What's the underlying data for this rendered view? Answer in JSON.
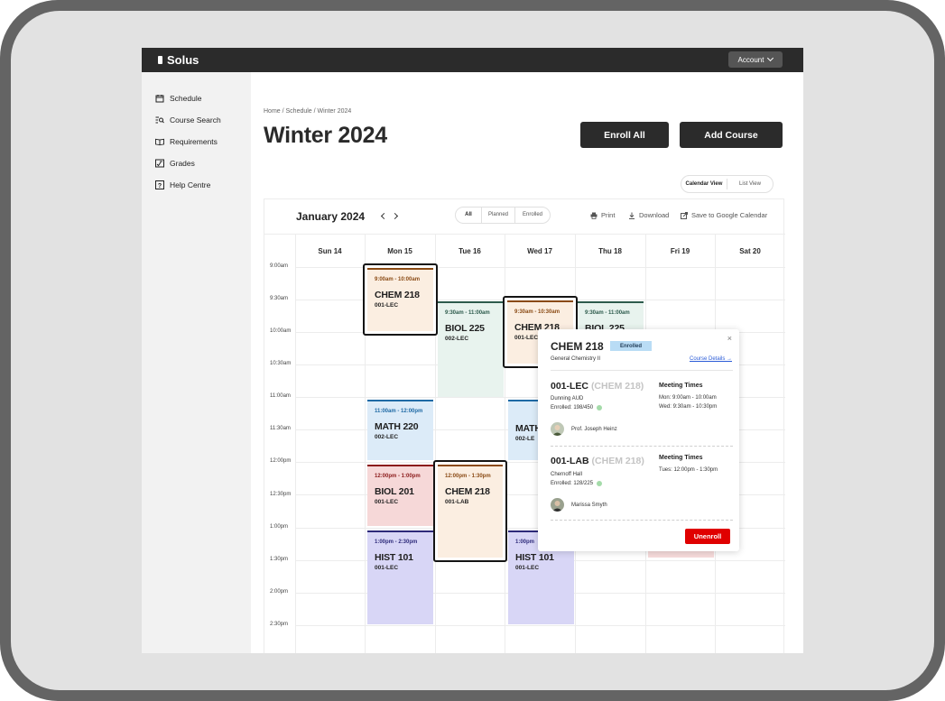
{
  "app": {
    "name": "Solus",
    "account_label": "Account"
  },
  "sidebar": {
    "items": [
      {
        "label": "Schedule",
        "icon": "calendar-icon"
      },
      {
        "label": "Course Search",
        "icon": "search-list-icon"
      },
      {
        "label": "Requirements",
        "icon": "book-icon"
      },
      {
        "label": "Grades",
        "icon": "grades-icon"
      },
      {
        "label": "Help Centre",
        "icon": "help-icon"
      }
    ]
  },
  "breadcrumb": "Home / Schedule / Winter 2024",
  "page_title": "Winter 2024",
  "actions": {
    "enroll_all": "Enroll All",
    "add_course": "Add Course"
  },
  "view_toggle": {
    "calendar": "Calendar View",
    "list": "List View",
    "active": "calendar"
  },
  "calendar": {
    "month": "January 2024",
    "filters": [
      "All",
      "Planned",
      "Enrolled"
    ],
    "active_filter": "All",
    "tools": {
      "print": "Print",
      "download": "Download",
      "google": "Save to Google Calendar"
    },
    "days": [
      "Sun 14",
      "Mon 15",
      "Tue 16",
      "Wed 17",
      "Thu 18",
      "Fri 19",
      "Sat 20"
    ],
    "times": [
      "9:00am",
      "9:30am",
      "10:00am",
      "10:30am",
      "11:00am",
      "11:30am",
      "12:00pm",
      "12:30pm",
      "1:00pm",
      "1:30pm",
      "2:00pm",
      "2:30pm"
    ],
    "events": [
      {
        "time": "9:00am - 10:00am",
        "code": "CHEM 218",
        "section": "001-LEC"
      },
      {
        "time": "9:30am - 11:00am",
        "code": "BIOL 225",
        "section": "002-LEC"
      },
      {
        "time": "9:30am - 10:30am",
        "code": "CHEM 218",
        "section": "001-LEC"
      },
      {
        "time": "9:30am - 11:00am",
        "code": "BIOL 225"
      },
      {
        "time": "11:00am - 12:00pm",
        "code": "MATH 220",
        "section": "002-LEC"
      },
      {
        "code": "MATH",
        "section": "002-LE"
      },
      {
        "time": "12:00pm - 1:00pm",
        "code": "BIOL 201",
        "section": "001-LEC"
      },
      {
        "time": "12:00pm - 1:30pm",
        "code": "CHEM 218",
        "section": "001-LAB"
      },
      {
        "time": "1:00pm - 2:30pm",
        "code": "HIST 101",
        "section": "001-LEC"
      },
      {
        "time": "1:00pm",
        "code": "HIST 101",
        "section": "001-LEC"
      }
    ],
    "colors": {
      "orange": "#8a4a14",
      "green": "#2d5b4c",
      "blue": "#1f6aa5",
      "red": "#8b1a1a",
      "purple": "#2d2a7a"
    }
  },
  "popup": {
    "course": "CHEM 218",
    "status": "Enrolled",
    "subtitle": "General Chemistry II",
    "details_link": "Course Details →",
    "close": "×",
    "meeting_times_label": "Meeting Times",
    "sections": [
      {
        "title": "001-LEC",
        "ghost": "(CHEM 218)",
        "location": "Dunning AUD",
        "enrolled": "Enrolled: 198/450",
        "instructor": "Prof. Joseph Heinz",
        "times": [
          "Mon: 9:00am - 10:00am",
          "Wed: 9:30am - 10:30pm"
        ]
      },
      {
        "title": "001-LAB",
        "ghost": "(CHEM 218)",
        "location": "Chernoff Hall",
        "enrolled": "Enrolled: 128/225",
        "instructor": "Marissa Smyth",
        "times": [
          "Tues: 12:00pm - 1:30pm"
        ]
      }
    ],
    "unenroll": "Unenroll"
  }
}
